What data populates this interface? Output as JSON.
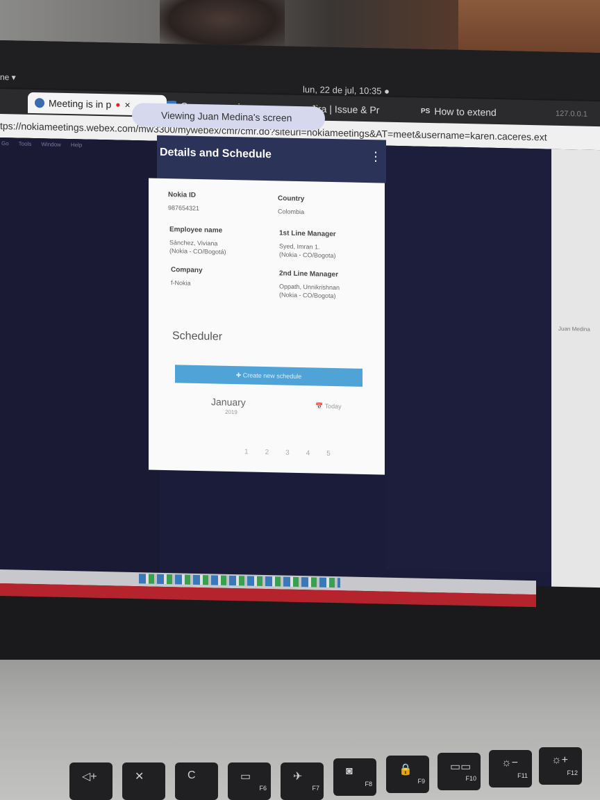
{
  "topbar": {
    "menu_label": "ne ▾",
    "clock": "lun, 22 de jul, 10:35 ●"
  },
  "tabs": [
    {
      "label": "Meeting is in p",
      "active": true,
      "close": "×"
    },
    {
      "label": "Correo: mauric"
    },
    {
      "label": "Jira | Issue & Pr"
    },
    {
      "label": "How to extend"
    },
    {
      "label": "127.0.0.1"
    }
  ],
  "url": "tps://nokiameetings.webex.com/mw3300/mywebex/cmr/cmr.do?siteurl=nokiameetings&AT=meet&username=karen.caceres.ext",
  "app_menu": [
    "Go",
    "Tools",
    "Window",
    "Help"
  ],
  "viewing_banner": "Viewing Juan Medina's screen",
  "right_panel_name": "Juan Medina",
  "details": {
    "title": "Details and Schedule",
    "more": "⋮",
    "fields": [
      {
        "label": "Nokia ID",
        "value": "987654321"
      },
      {
        "label": "Country",
        "value": "Colombia"
      },
      {
        "label": "Employee name",
        "value": "Sánchez, Viviana\n(Nokia - CO/Bogotá)"
      },
      {
        "label": "1st Line Manager",
        "value": "Syed, Imran 1.\n(Nokia - CO/Bogota)"
      },
      {
        "label": "Company",
        "value": "f-Nokia"
      },
      {
        "label": "2nd Line Manager",
        "value": "Oppath, Unnikrishnan\n(Nokia - CO/Bogota)"
      }
    ]
  },
  "scheduler": {
    "title": "Scheduler",
    "create_button": "✚ Create new schedule",
    "month": "January",
    "year": "2019",
    "today": "Today",
    "days": [
      "1",
      "2",
      "3",
      "4",
      "5"
    ]
  },
  "keyboard": {
    "keys": [
      {
        "sym": "◁+",
        "label": ""
      },
      {
        "sym": "✕",
        "label": ""
      },
      {
        "sym": "C",
        "label": ""
      },
      {
        "sym": "▭",
        "label": "F6"
      },
      {
        "sym": "✈",
        "label": "F7"
      },
      {
        "sym": "◙",
        "label": "F8"
      },
      {
        "sym": "🔒",
        "label": "F9"
      },
      {
        "sym": "▭▭",
        "label": "F10"
      },
      {
        "sym": "☼−",
        "label": "F11"
      },
      {
        "sym": "☼+",
        "label": "F12"
      }
    ]
  }
}
